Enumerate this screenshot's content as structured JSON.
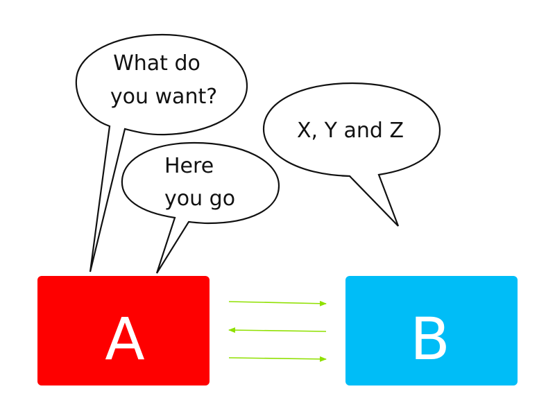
{
  "colors": {
    "node_a": "#fe0000",
    "node_b": "#00bdf7",
    "arrow": "#8fe000",
    "bubble_stroke": "#111111",
    "text_dark": "#111111",
    "text_light": "#ffffff"
  },
  "nodes": {
    "a": {
      "label": "A"
    },
    "b": {
      "label": "B"
    }
  },
  "bubbles": {
    "what_do_you_want": {
      "line1": "What do",
      "line2": "you want?"
    },
    "here_you_go": {
      "line1": "Here",
      "line2": "you go"
    },
    "xyz": {
      "line1": "X, Y and Z"
    }
  },
  "arrows": [
    {
      "direction": "a-to-b"
    },
    {
      "direction": "b-to-a"
    },
    {
      "direction": "a-to-b"
    }
  ]
}
